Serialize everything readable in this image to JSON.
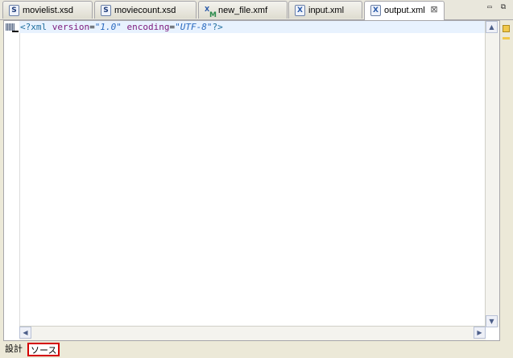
{
  "tabs": [
    {
      "label": "movielist.xsd",
      "icon": "S"
    },
    {
      "label": "moviecount.xsd",
      "icon": "S"
    },
    {
      "label": "new_file.xmf",
      "icon": "XM"
    },
    {
      "label": "input.xml",
      "icon": "X"
    },
    {
      "label": "output.xml",
      "icon": "X",
      "active": true,
      "close": "⊠"
    }
  ],
  "window_controls": {
    "minimize": "▭",
    "maximize": "⧉"
  },
  "editor": {
    "line1": {
      "open": "<?",
      "tag": "xml",
      "attr1": "version",
      "eq1": "=",
      "val1": "\"1.0\"",
      "attr2": "encoding",
      "eq2": "=",
      "val2": "\"UTF-8\"",
      "close": "?>"
    }
  },
  "scroll": {
    "up": "▲",
    "down": "▼",
    "left": "◀",
    "right": "▶"
  },
  "bottom_tabs": {
    "design": "設計",
    "source": "ソース"
  },
  "colors": {
    "accent_border": "#d40000",
    "current_line": "#e8f2fe"
  }
}
